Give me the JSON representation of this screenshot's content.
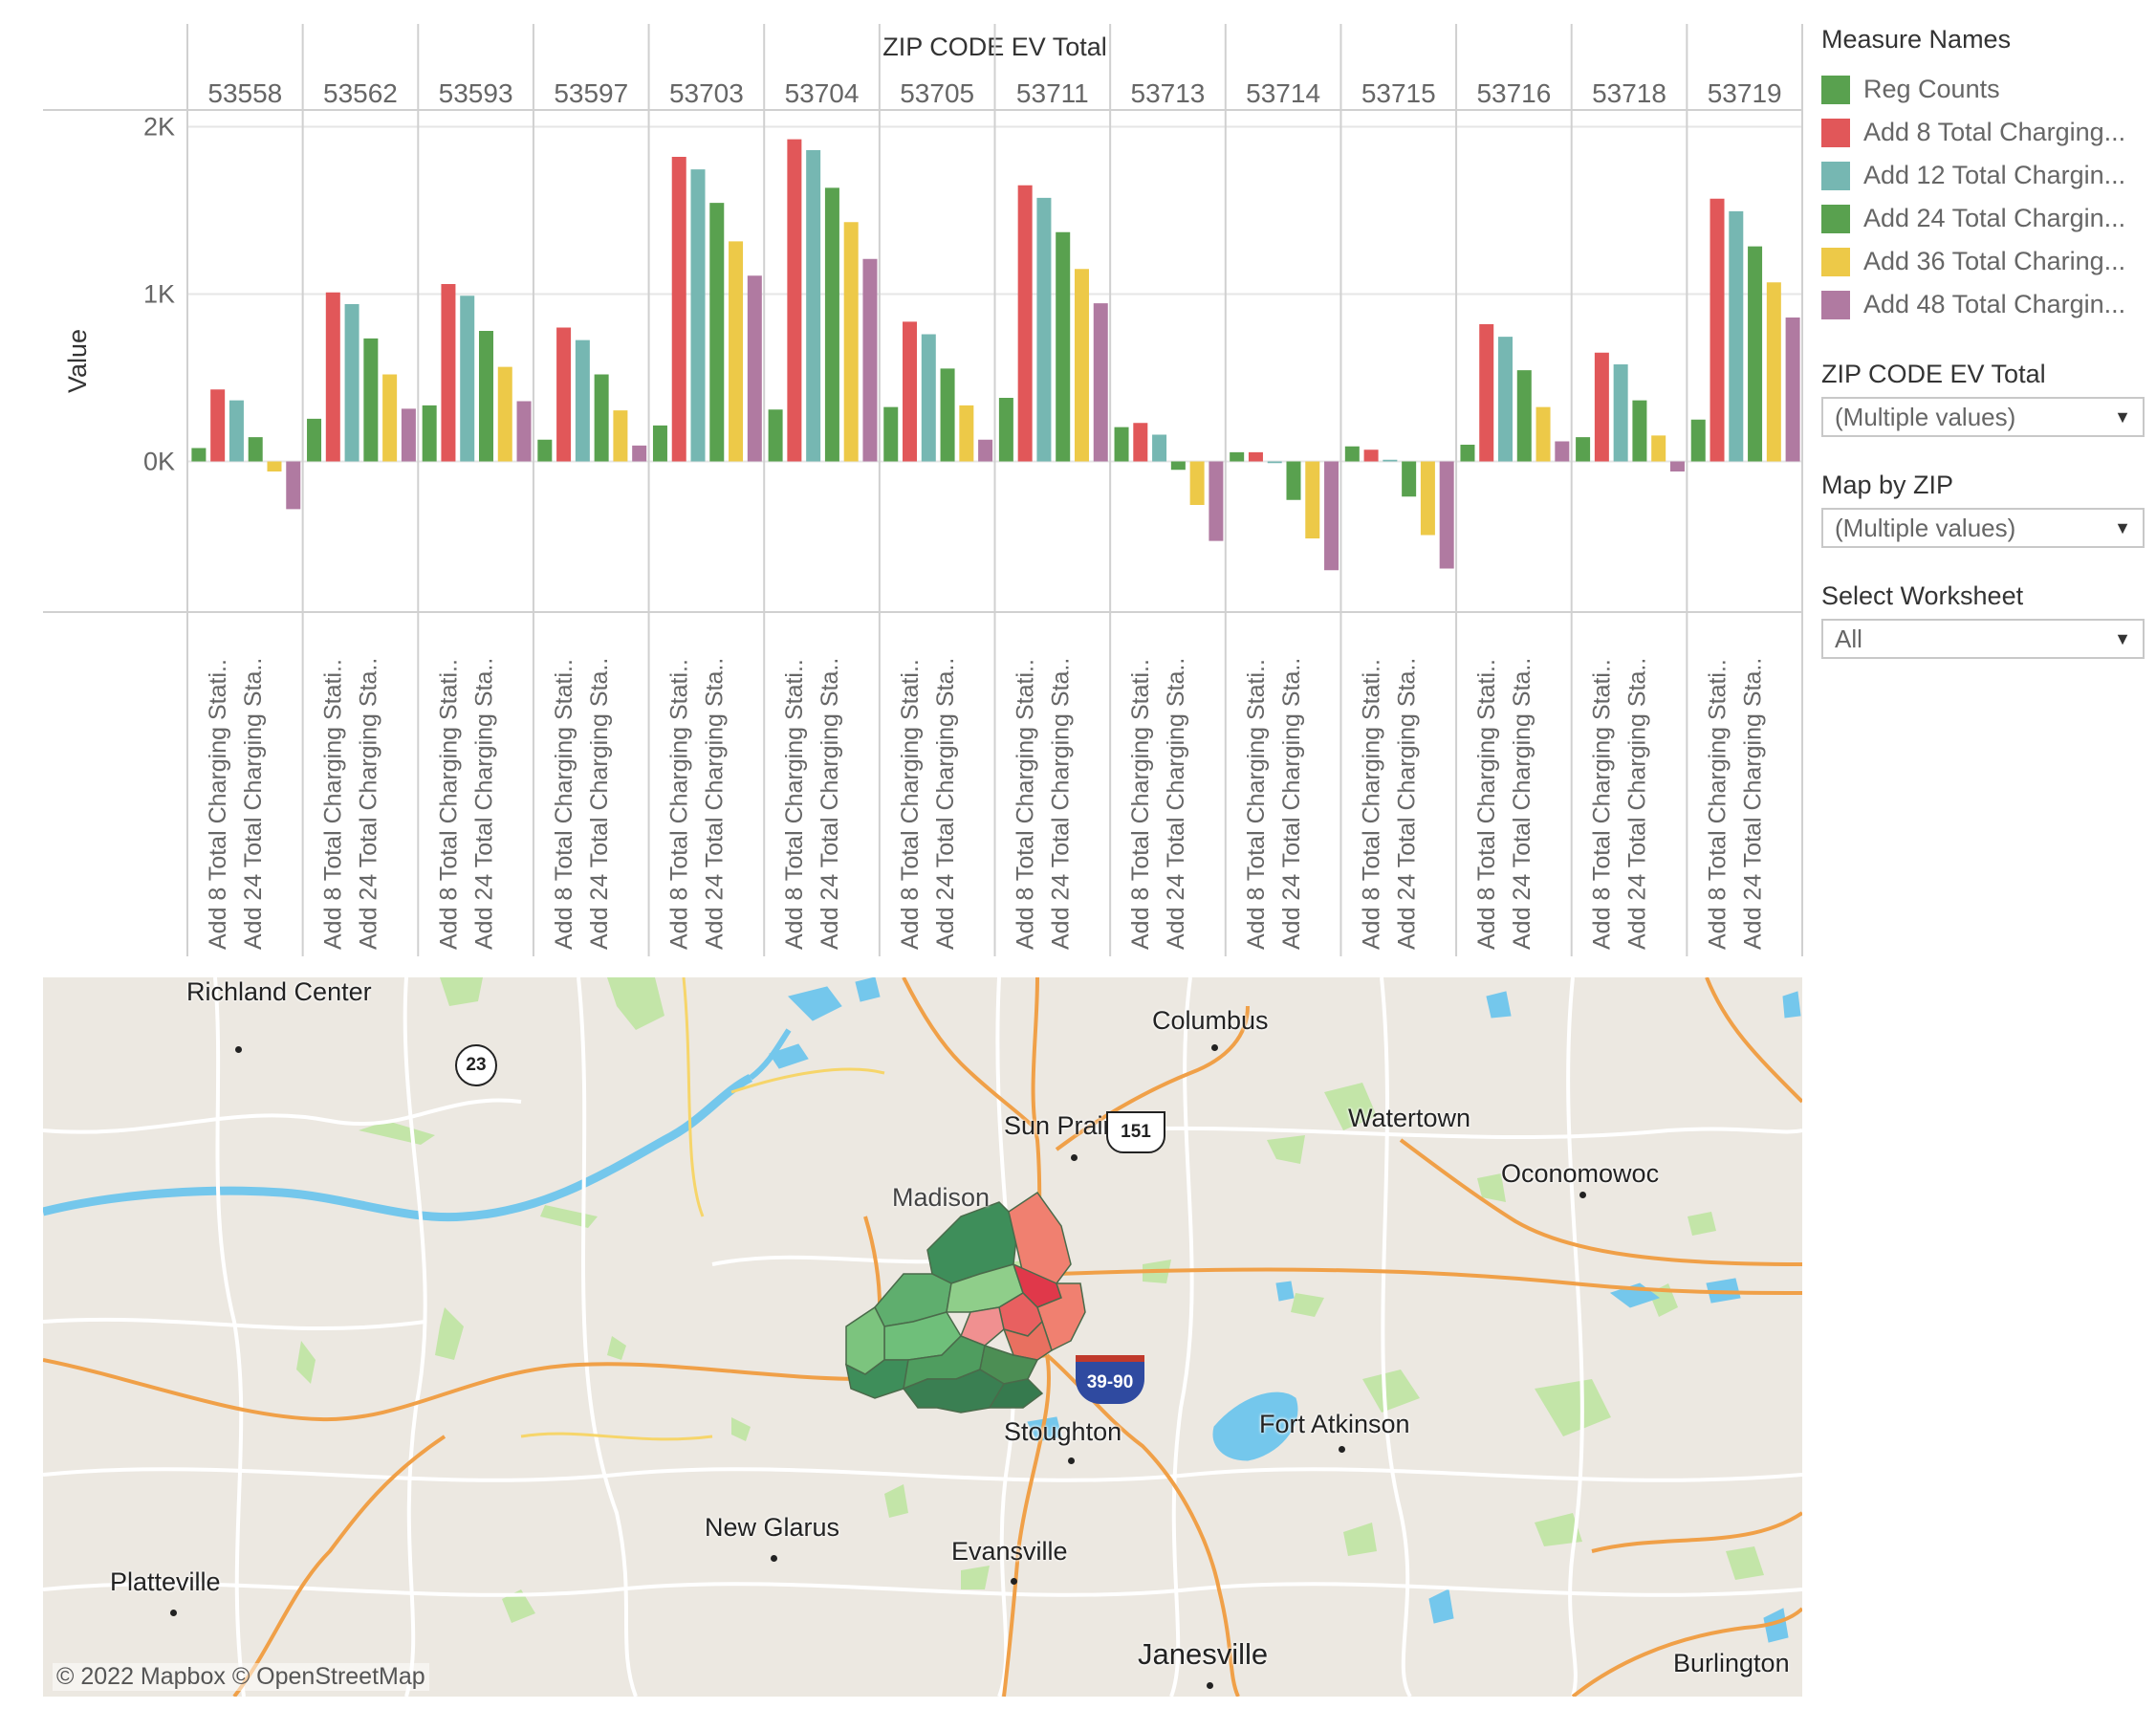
{
  "chart_data": {
    "type": "bar",
    "title": "ZIP CODE EV Total",
    "ylabel": "Value",
    "ylim": [
      -900,
      2100
    ],
    "yticks": [
      0,
      1000,
      2000
    ],
    "ytick_labels": [
      "0K",
      "1K",
      "2K"
    ],
    "grid": true,
    "categories": [
      "53558",
      "53562",
      "53593",
      "53597",
      "53703",
      "53704",
      "53705",
      "53711",
      "53713",
      "53714",
      "53715",
      "53716",
      "53718",
      "53719"
    ],
    "x_sub_labels": [
      "Add 8 Total Charging Stati..",
      "Add 24 Total Charging Sta.."
    ],
    "series": [
      {
        "name": "Reg Counts",
        "color": "#59a14f",
        "values": [
          80,
          255,
          335,
          130,
          215,
          310,
          325,
          380,
          205,
          55,
          90,
          100,
          145,
          250
        ]
      },
      {
        "name": "Add 8 Total Charging...",
        "color": "#e15759",
        "values": [
          430,
          1010,
          1060,
          800,
          1820,
          1925,
          835,
          1650,
          230,
          55,
          70,
          820,
          650,
          1570
        ]
      },
      {
        "name": "Add 12 Total Chargin...",
        "color": "#76b7b2",
        "values": [
          365,
          940,
          990,
          725,
          1745,
          1860,
          760,
          1575,
          160,
          -10,
          10,
          745,
          580,
          1495
        ]
      },
      {
        "name": "Add 24 Total Chargin...",
        "color": "#59a14f",
        "values": [
          145,
          735,
          780,
          520,
          1545,
          1635,
          555,
          1370,
          -50,
          -230,
          -210,
          545,
          365,
          1285
        ]
      },
      {
        "name": "Add 36 Total Charing...",
        "color": "#edc948",
        "values": [
          -60,
          520,
          565,
          305,
          1315,
          1430,
          335,
          1150,
          -260,
          -460,
          -440,
          325,
          155,
          1070
        ]
      },
      {
        "name": "Add 48 Total Chargin...",
        "color": "#b07aa1",
        "values": [
          -285,
          315,
          360,
          95,
          1110,
          1210,
          130,
          945,
          -475,
          -650,
          -640,
          120,
          -60,
          860
        ]
      }
    ]
  },
  "legend": {
    "title": "Measure Names",
    "items": [
      {
        "label": "Reg Counts",
        "color": "#59a14f"
      },
      {
        "label": "Add 8 Total Charging...",
        "color": "#e15759"
      },
      {
        "label": "Add 12 Total Chargin...",
        "color": "#76b7b2"
      },
      {
        "label": "Add 24 Total Chargin...",
        "color": "#59a14f"
      },
      {
        "label": "Add 36 Total Charing...",
        "color": "#edc948"
      },
      {
        "label": "Add 48 Total Chargin...",
        "color": "#b07aa1"
      }
    ]
  },
  "filters": [
    {
      "title": "ZIP CODE EV Total",
      "value": "(Multiple values)"
    },
    {
      "title": "Map by ZIP",
      "value": "(Multiple values)"
    },
    {
      "title": "Select Worksheet",
      "value": "All"
    }
  ],
  "map": {
    "cities": [
      "Richland Center",
      "Columbus",
      "Sun Prairie",
      "Watertown",
      "Oconomowoc",
      "Madison",
      "Stoughton",
      "Fort Atkinson",
      "New Glarus",
      "Evansville",
      "Platteville",
      "Janesville",
      "Burlington"
    ],
    "shields": {
      "us": "151",
      "state": "23",
      "interstate": "39-90"
    },
    "credit": "© 2022 Mapbox  © OpenStreetMap",
    "colors": {
      "land": "#ece8e1",
      "water": "#74c7ec",
      "park": "#c3e5a8",
      "highway": "#f0a048",
      "road": "#ffffff"
    }
  }
}
